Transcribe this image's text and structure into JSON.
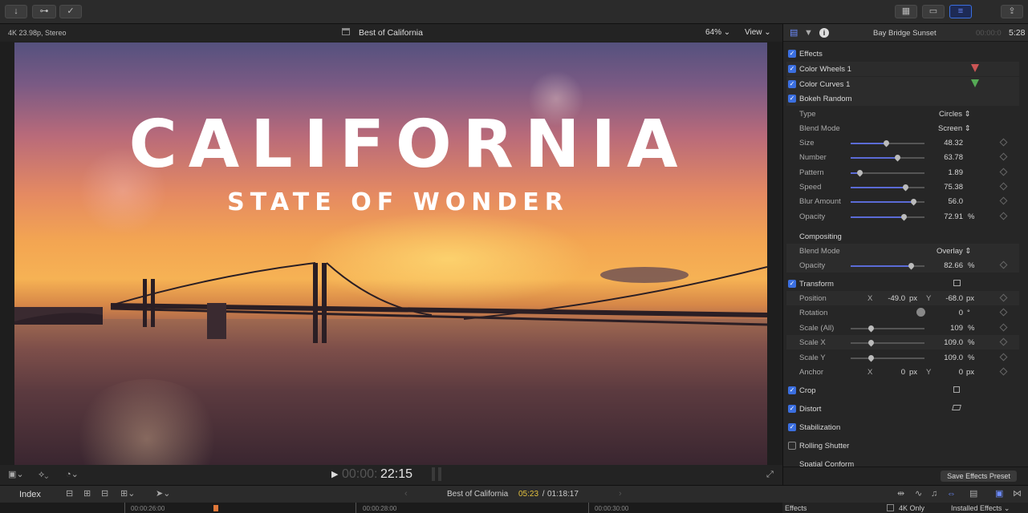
{
  "toolbar": {
    "import_icon": "↓",
    "keyword_icon": "⊶",
    "check_icon": "✓",
    "browser_icon": "▦",
    "timeline_icon": "▭",
    "inspector_icon": "≡",
    "share_icon": "⇪"
  },
  "viewer": {
    "format": "4K 23.98p, Stereo",
    "project_name": "Best of California",
    "zoom": "64%",
    "view_menu": "View",
    "title_main": "CALIFORNIA",
    "title_sub": "STATE OF WONDER",
    "timecode_dim": "00:00:",
    "timecode_bright": "22:15"
  },
  "inspector": {
    "clip_name": "Bay Bridge Sunset",
    "duration_dim": "00:00:0",
    "duration_bright": "5:28",
    "effects_header": "Effects",
    "effects": [
      {
        "label": "Color Wheels 1"
      },
      {
        "label": "Color Curves 1"
      },
      {
        "label": "Bokeh Random"
      }
    ],
    "bokeh": {
      "type_label": "Type",
      "type_value": "Circles",
      "blend_label": "Blend Mode",
      "blend_value": "Screen",
      "params": [
        {
          "label": "Size",
          "value": "48.32",
          "unit": "",
          "level": 0.48
        },
        {
          "label": "Number",
          "value": "63.78",
          "unit": "",
          "level": 0.63
        },
        {
          "label": "Pattern",
          "value": "1.89",
          "unit": "",
          "level": 0.12
        },
        {
          "label": "Speed",
          "value": "75.38",
          "unit": "",
          "level": 0.74
        },
        {
          "label": "Blur Amount",
          "value": "56.0",
          "unit": "",
          "level": 0.85
        },
        {
          "label": "Opacity",
          "value": "72.91",
          "unit": "%",
          "level": 0.72
        }
      ]
    },
    "compositing": {
      "header": "Compositing",
      "blend_label": "Blend Mode",
      "blend_value": "Overlay",
      "opacity_label": "Opacity",
      "opacity_value": "82.66",
      "opacity_unit": "%",
      "opacity_level": 0.82
    },
    "transform": {
      "header": "Transform",
      "position_label": "Position",
      "x_label": "X",
      "pos_x": "-49.0",
      "px1": "px",
      "y_label": "Y",
      "pos_y": "-68.0",
      "px2": "px",
      "rotation_label": "Rotation",
      "rotation_value": "0",
      "deg": "°",
      "scales": [
        {
          "label": "Scale (All)",
          "value": "109",
          "unit": "%"
        },
        {
          "label": "Scale X",
          "value": "109.0",
          "unit": "%"
        },
        {
          "label": "Scale Y",
          "value": "109.0",
          "unit": "%"
        }
      ],
      "anchor_label": "Anchor",
      "ax_label": "X",
      "anchor_x": "0",
      "apx1": "px",
      "ay_label": "Y",
      "anchor_y": "0",
      "apx2": "px"
    },
    "sections": [
      {
        "label": "Crop",
        "checked": true
      },
      {
        "label": "Distort",
        "checked": true
      },
      {
        "label": "Stabilization",
        "checked": true
      },
      {
        "label": "Rolling Shutter",
        "checked": false
      }
    ],
    "spatial_conform": "Spatial Conform",
    "save_preset": "Save Effects Preset"
  },
  "timeline": {
    "index": "Index",
    "project_name": "Best of California",
    "current_time": "05:23",
    "separator": " / ",
    "total_time": "01:18:17",
    "ruler_ticks": [
      "00:00:26:00",
      "00:00:28:00",
      "00:00:30:00"
    ],
    "effects_tab": "Effects",
    "filter_4k": "4K Only",
    "installed_effects": "Installed Effects"
  }
}
